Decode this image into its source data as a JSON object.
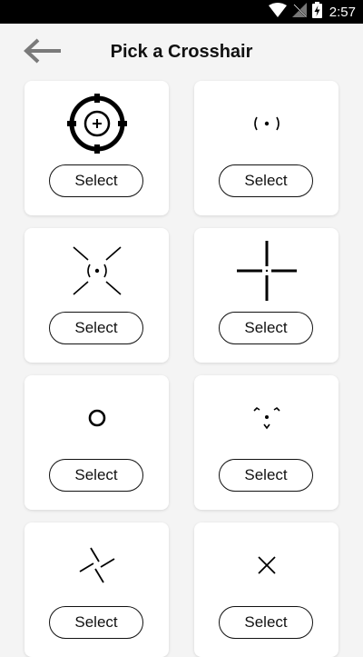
{
  "status_bar": {
    "time": "2:57",
    "icons": [
      "wifi-icon",
      "no-signal-icon",
      "battery-charging-icon"
    ]
  },
  "header": {
    "title": "Pick a Crosshair",
    "back_icon": "back-arrow-icon"
  },
  "crosshairs": [
    {
      "icon": "scope-crosshair-icon",
      "select_label": "Select"
    },
    {
      "icon": "dot-parentheses-crosshair-icon",
      "select_label": "Select"
    },
    {
      "icon": "diagonal-dot-crosshair-icon",
      "select_label": "Select"
    },
    {
      "icon": "plus-gap-crosshair-icon",
      "select_label": "Select"
    },
    {
      "icon": "circle-crosshair-icon",
      "select_label": "Select"
    },
    {
      "icon": "chevron-dot-crosshair-icon",
      "select_label": "Select"
    },
    {
      "icon": "pinwheel-crosshair-icon",
      "select_label": "Select"
    },
    {
      "icon": "x-crosshair-icon",
      "select_label": "Select"
    }
  ]
}
